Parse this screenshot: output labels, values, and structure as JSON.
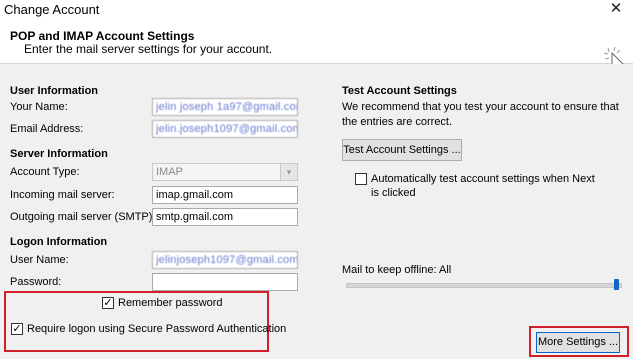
{
  "window": {
    "title": "Change Account"
  },
  "header": {
    "title": "POP and IMAP Account Settings",
    "subtitle": "Enter the mail server settings for your account."
  },
  "user_info": {
    "heading": "User Information",
    "name_label": "Your Name:",
    "name_value": "jеlin jоsеph 1а97@gmail.com",
    "email_label": "Email Address:",
    "email_value": "jelin.jоsеph1097@gmail.com"
  },
  "server_info": {
    "heading": "Server Information",
    "account_type_label": "Account Type:",
    "account_type_value": "IMAP",
    "incoming_label": "Incoming mail server:",
    "incoming_value": "imap.gmail.com",
    "outgoing_label": "Outgoing mail server (SMTP):",
    "outgoing_value": "smtp.gmail.com"
  },
  "logon_info": {
    "heading": "Logon Information",
    "username_label": "User Name:",
    "username_value": "jelinjoseph1097@gmail.com",
    "password_label": "Password:",
    "password_value": "",
    "remember_label": "Remember password",
    "remember_checked": true,
    "spa_label": "Require logon using Secure Password Authentication",
    "spa_checked": true
  },
  "test_settings": {
    "heading": "Test Account Settings",
    "description": "We recommend that you test your account to ensure that the entries are correct.",
    "button_label": "Test Account Settings ...",
    "auto_test_label": "Automatically test account settings when Next is clicked",
    "auto_test_checked": false
  },
  "offline": {
    "label": "Mail to keep offline:",
    "value": "All",
    "slider_fraction": 1.0
  },
  "more_settings": {
    "label": "More Settings ..."
  },
  "colors": {
    "highlight": "#d2202a",
    "panel_bg": "#f0f0f0"
  }
}
